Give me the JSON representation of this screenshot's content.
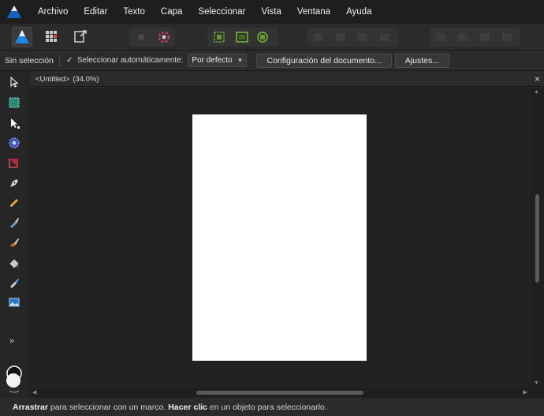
{
  "menubar": {
    "logo_icon": "affinity-designer-logo-icon",
    "items": [
      "Archivo",
      "Editar",
      "Texto",
      "Capa",
      "Seleccionar",
      "Vista",
      "Ventana",
      "Ayuda"
    ]
  },
  "toolbar": {
    "personas": [
      "designer-persona-icon",
      "pixel-persona-icon",
      "export-persona-icon"
    ]
  },
  "contextbar": {
    "selection_label": "Sin selección",
    "auto_select_label": "Seleccionar automáticamente:",
    "auto_select_checked": true,
    "auto_select_value": "Por defecto",
    "document_setup_label": "Configuración del documento...",
    "preferences_label": "Ajustes..."
  },
  "document": {
    "tab_title": "<Untitled>",
    "zoom": "(34.0%)"
  },
  "status": {
    "bold1": "Arrastrar",
    "text1": " para seleccionar con un marco. ",
    "bold2": "Hacer clic",
    "text2": " en un objeto para seleccionarlo."
  },
  "colors": {
    "accent": "#1e88e5",
    "background": "#222222",
    "panel": "#2b2b2b",
    "artboard": "#ffffff"
  }
}
